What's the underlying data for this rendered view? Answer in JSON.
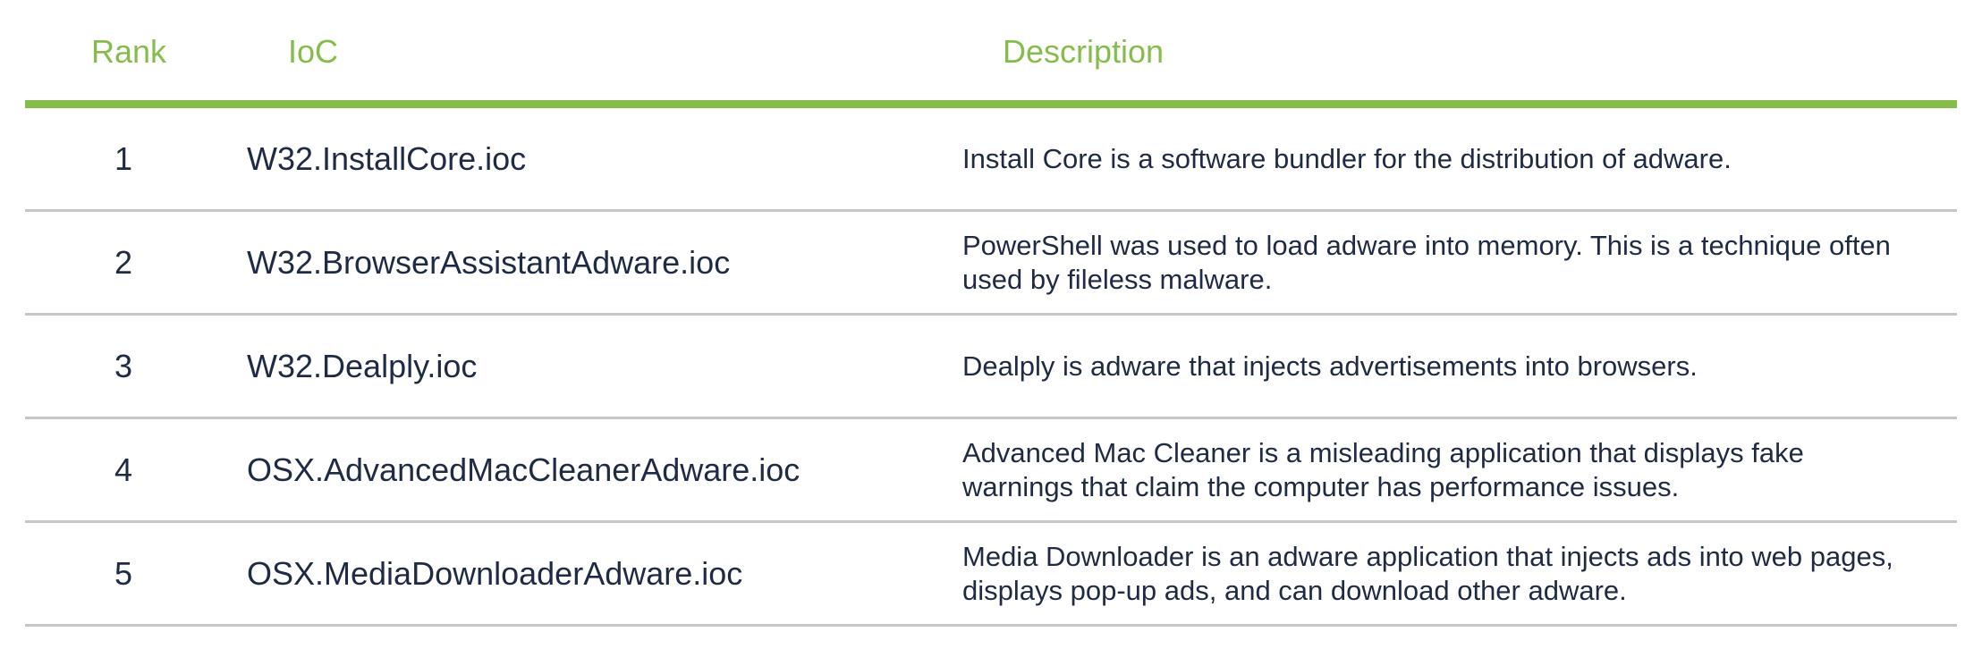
{
  "table": {
    "headers": {
      "rank": "Rank",
      "ioc": "IoC",
      "description": "Description"
    },
    "rows": [
      {
        "rank": "1",
        "ioc": "W32.InstallCore.ioc",
        "description": "Install Core is a software bundler for the distribution of adware."
      },
      {
        "rank": "2",
        "ioc": "W32.BrowserAssistantAdware.ioc",
        "description": "PowerShell was used to load adware into memory. This is a technique often used by fileless malware."
      },
      {
        "rank": "3",
        "ioc": "W32.Dealply.ioc",
        "description": "Dealply is adware that injects advertisements into browsers."
      },
      {
        "rank": "4",
        "ioc": "OSX.AdvancedMacCleanerAdware.ioc",
        "description": "Advanced Mac Cleaner is a misleading application that displays fake warnings that claim the computer has performance issues."
      },
      {
        "rank": "5",
        "ioc": "OSX.MediaDownloaderAdware.ioc",
        "description": "Media Downloader is an adware application that injects ads into web pages, displays pop-up ads, and can download other adware."
      }
    ]
  },
  "colors": {
    "accent": "#86bc4b",
    "text": "#1f2a44",
    "divider": "#c6c6c6"
  }
}
